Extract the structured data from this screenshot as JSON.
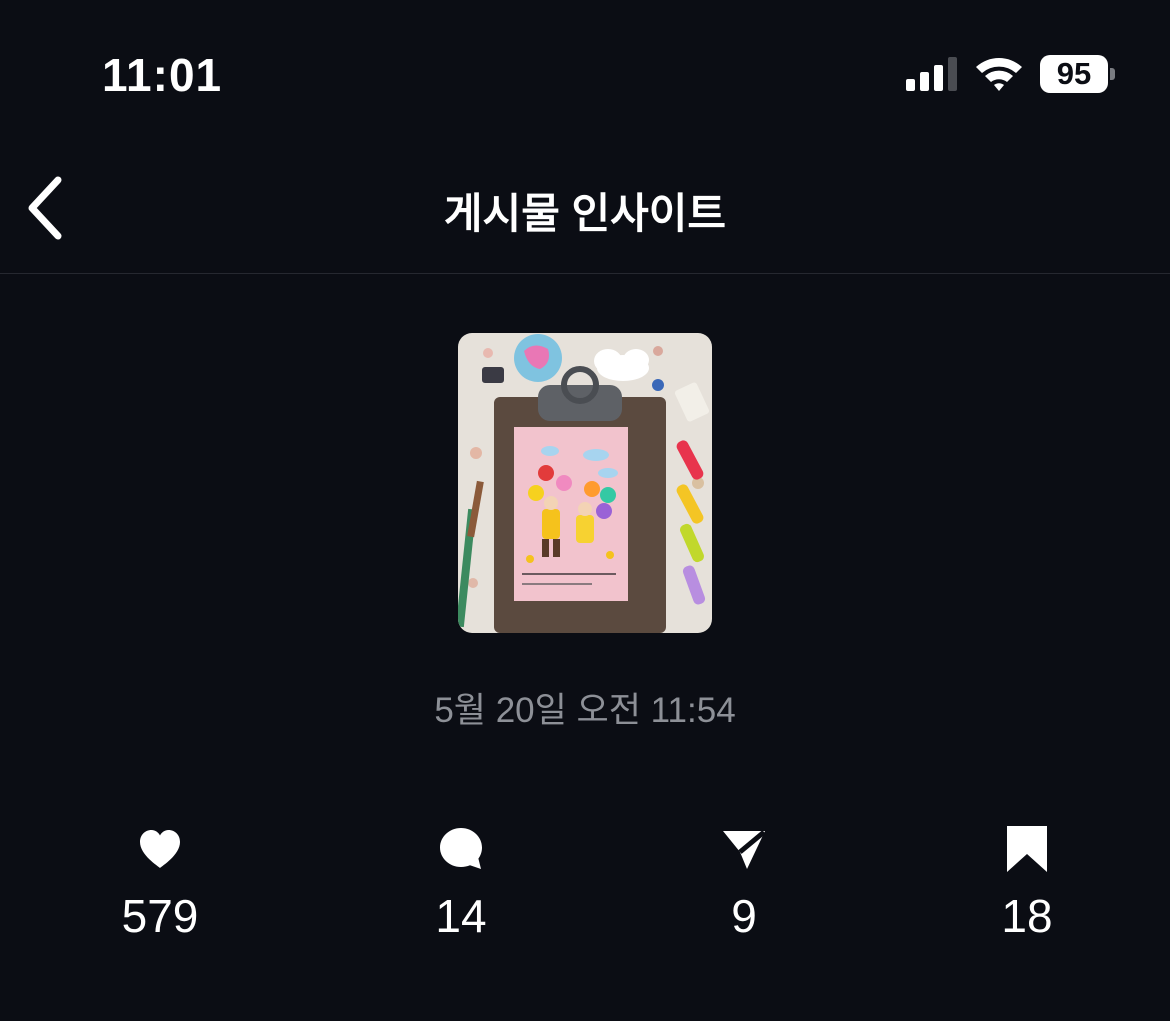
{
  "status_bar": {
    "time": "11:01",
    "battery_level": "95",
    "signal_icon": "cellular-signal-icon",
    "wifi_icon": "wifi-icon"
  },
  "header": {
    "title": "게시물 인사이트",
    "back_icon": "chevron-left-icon"
  },
  "post": {
    "date": "5월 20일 오전 11:54"
  },
  "metrics": [
    {
      "icon": "heart-icon",
      "value": "579"
    },
    {
      "icon": "comment-icon",
      "value": "14"
    },
    {
      "icon": "send-icon",
      "value": "9"
    },
    {
      "icon": "bookmark-icon",
      "value": "18"
    }
  ],
  "colors": {
    "background": "#0b0d14",
    "text": "#ffffff",
    "muted": "#8d9097"
  }
}
